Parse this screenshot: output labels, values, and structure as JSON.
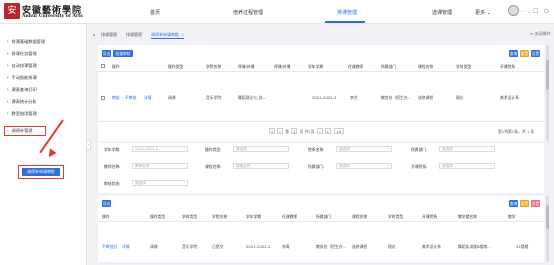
{
  "header": {
    "logo_mark": "安",
    "logo_cn": "安徽藝術學院",
    "logo_en": "Anhui University of Arts",
    "nav": [
      {
        "label": "首页"
      },
      {
        "label": "培养过程管理"
      },
      {
        "label": "排课管理"
      },
      {
        "label": "选课管理"
      },
      {
        "label": "更多 ⌄"
      }
    ],
    "user_name": "· · · ⌄"
  },
  "sidebar": {
    "items": [
      {
        "label": "排课基础数据管理"
      },
      {
        "label": "排课任务管理"
      },
      {
        "label": "自动排课管理"
      },
      {
        "label": "手动智能排课"
      },
      {
        "label": "课表查询打印"
      },
      {
        "label": "课表统计分析"
      },
      {
        "label": "教室借用管理"
      },
      {
        "label": "调停补管理"
      }
    ],
    "sub_item": "调停补申请审批"
  },
  "tabs": {
    "items": [
      {
        "label": "排课管理"
      },
      {
        "label": "排课管理"
      },
      {
        "label": "调停补申请审批"
      }
    ],
    "close": "✕",
    "right_label": "≡ 关闭操作"
  },
  "top_panel": {
    "buttons": {
      "export": "导出",
      "submit": "批量审核",
      "query": "查询",
      "reset": "重置",
      "settings": "设置"
    },
    "columns": [
      "操作",
      "操作类型",
      "学院名称",
      "停课/补课",
      "学年学期",
      "任课教师",
      "所属部门",
      "课程名称",
      "学时类型",
      "开课院系"
    ],
    "row": {
      "actions": [
        "审批",
        "不审批",
        "详情"
      ],
      "op_type": "调课",
      "college": "音乐学院",
      "course": "舞蹈理论与_技...",
      "term": "2021-2022-2",
      "teacher": "李艺",
      "dept": "教务处（招生办...",
      "course_name": "选修课程",
      "hours_type": "理论",
      "open_dept": "美术设计系"
    },
    "pager": {
      "first": "«",
      "prev": "‹",
      "page_label": "第",
      "page": "1",
      "of": "页 共1页",
      "next": "›",
      "last": "»",
      "size": "10",
      "summary": "第1到第1条，共 1 条"
    }
  },
  "filters": [
    {
      "label": "学年学期:",
      "value": "2021-2022-2"
    },
    {
      "label": "操作类型:",
      "value": "请选择"
    },
    {
      "label": "院系名称:",
      "value": "请选择"
    },
    {
      "label": "所属部门:",
      "value": "请选择"
    },
    {
      "label": "教师名称:",
      "value": "教师名称"
    },
    {
      "label": "课程名称:",
      "value": "课程名称"
    },
    {
      "label": "所属部门:",
      "value": "请选择"
    },
    {
      "label": "开课院系:",
      "value": "请选择"
    },
    {
      "label": "审核状态:",
      "value": "请选择"
    }
  ],
  "bottom_panel": {
    "buttons": {
      "export": "导出",
      "query": "查询",
      "reset": "重置",
      "settings": "设置"
    },
    "columns": [
      "操作",
      "操作类型",
      "学时类型",
      "学院名称",
      "学年学期",
      "任课教师",
      "所属部门",
      "课程名称",
      "学时类型",
      "开课院系",
      "教学楼名称",
      "教学"
    ],
    "row": {
      "actions": [
        "不审批后",
        "详情"
      ],
      "op_type": "调课",
      "hours": "音乐学院",
      "status": "已提交",
      "term": "2021-2022-2",
      "teacher": "李青",
      "dept": "教务处（招生办...",
      "course_name": "选修课程",
      "hours_type": "理论",
      "open_dept": "美术设计系",
      "building": "舞蹈实训楼B楼南...",
      "extra": "31楼楼"
    }
  },
  "colors": {
    "accent": "#2f6fd6",
    "highlight": "#e53935",
    "orange": "#f0a020",
    "pink": "#e66a86"
  }
}
